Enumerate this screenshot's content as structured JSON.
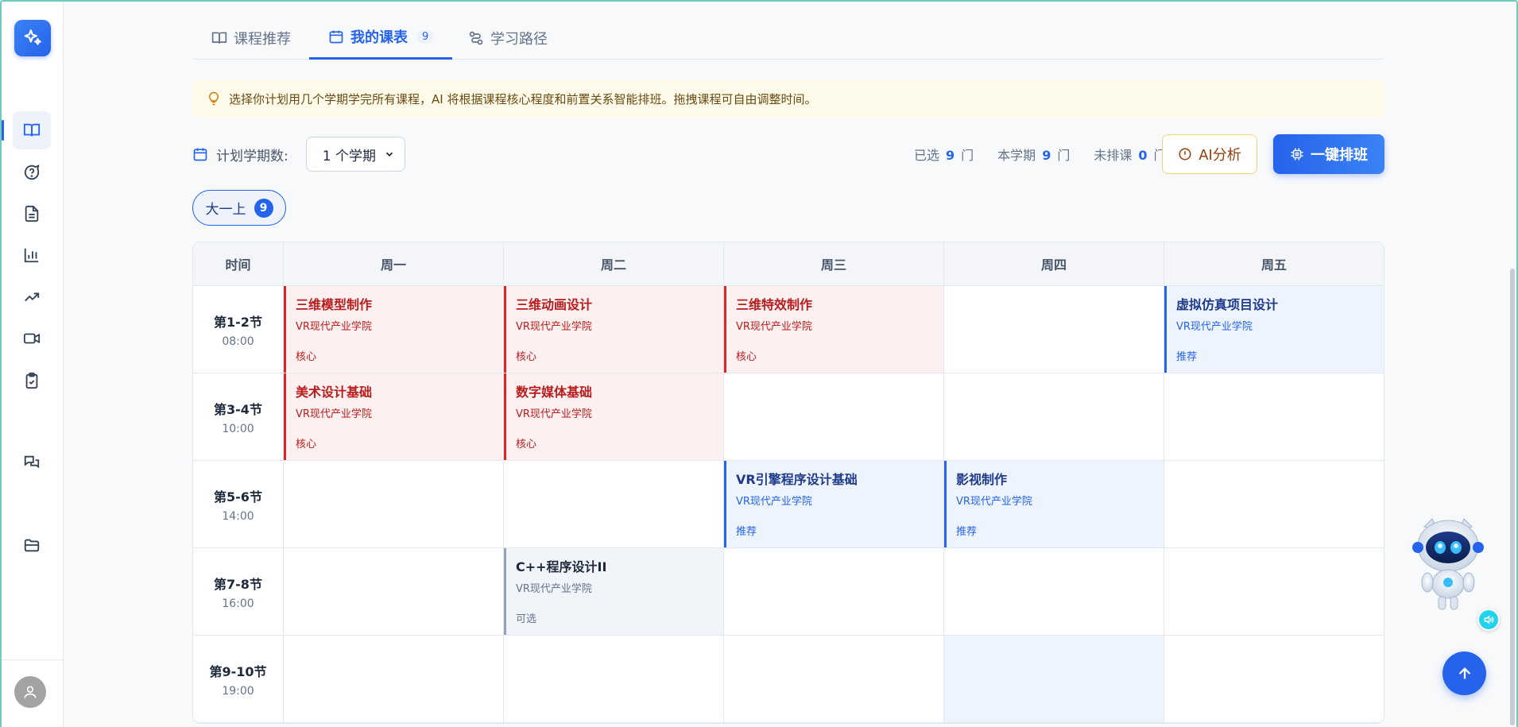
{
  "sidebar": {
    "nav": [
      "book",
      "help-circle",
      "document",
      "bar-chart",
      "trending-up",
      "video",
      "clipboard-check",
      "chat",
      "folder"
    ]
  },
  "tabs": [
    {
      "label": "课程推荐",
      "icon": "book-icon"
    },
    {
      "label": "我的课表",
      "icon": "calendar-icon",
      "badge": "9"
    },
    {
      "label": "学习路径",
      "icon": "path-icon"
    }
  ],
  "tip": "选择你计划用几个学期学完所有课程，AI 将根据课程核心程度和前置关系智能排班。拖拽课程可自由调整时间。",
  "controls": {
    "label": "计划学期数:",
    "select_value": "1 个学期",
    "selected_label": "已选",
    "selected_count": "9",
    "this_term_label": "本学期",
    "this_term_count": "9",
    "unscheduled_label": "未排课",
    "unscheduled_count": "0",
    "unit": "门",
    "ai_button": "AI分析",
    "auto_button": "一键排班"
  },
  "semester": {
    "label": "大一上",
    "count": "9"
  },
  "colors": {
    "core": "#dc2626",
    "recommend": "#2563eb",
    "optional": "#94a3b8",
    "accent": "#2563eb"
  },
  "timetable": {
    "time_header": "时间",
    "days": [
      "周一",
      "周二",
      "周三",
      "周四",
      "周五"
    ],
    "periods": [
      {
        "label": "第1-2节",
        "time": "08:00"
      },
      {
        "label": "第3-4节",
        "time": "10:00"
      },
      {
        "label": "第5-6节",
        "time": "14:00"
      },
      {
        "label": "第7-8节",
        "time": "16:00"
      },
      {
        "label": "第9-10节",
        "time": "19:00"
      }
    ],
    "courses": [
      {
        "name": "三维模型制作",
        "college": "VR现代产业学院",
        "tag": "核心",
        "type": "core",
        "day": 0,
        "period": 0
      },
      {
        "name": "三维动画设计",
        "college": "VR现代产业学院",
        "tag": "核心",
        "type": "core",
        "day": 1,
        "period": 0
      },
      {
        "name": "三维特效制作",
        "college": "VR现代产业学院",
        "tag": "核心",
        "type": "core",
        "day": 2,
        "period": 0
      },
      {
        "name": "虚拟仿真项目设计",
        "college": "VR现代产业学院",
        "tag": "推荐",
        "type": "rec",
        "day": 4,
        "period": 0
      },
      {
        "name": "美术设计基础",
        "college": "VR现代产业学院",
        "tag": "核心",
        "type": "core",
        "day": 0,
        "period": 1
      },
      {
        "name": "数字媒体基础",
        "college": "VR现代产业学院",
        "tag": "核心",
        "type": "core",
        "day": 1,
        "period": 1
      },
      {
        "name": "VR引擎程序设计基础",
        "college": "VR现代产业学院",
        "tag": "推荐",
        "type": "rec",
        "day": 2,
        "period": 2
      },
      {
        "name": "影视制作",
        "college": "VR现代产业学院",
        "tag": "推荐",
        "type": "rec",
        "day": 3,
        "period": 2
      },
      {
        "name": "C++程序设计II",
        "college": "VR现代产业学院",
        "tag": "可选",
        "type": "opt",
        "day": 1,
        "period": 3
      }
    ]
  }
}
